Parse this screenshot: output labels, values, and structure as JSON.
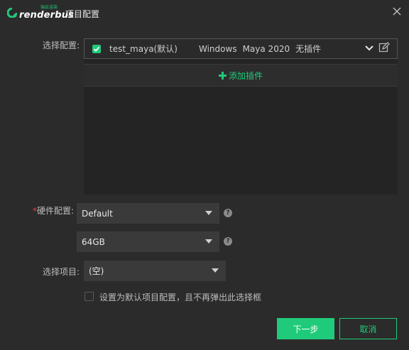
{
  "app": {
    "logo_tag": "瑞云渲染",
    "logo_word": "renderbus",
    "window_title": "项目配置"
  },
  "form": {
    "select_config_label": "选择配置:",
    "config_item": {
      "name": "test_maya(默认)",
      "os": "Windows",
      "software": "Maya 2020",
      "plugin": "无插件",
      "checked": true
    },
    "add_plugin_label": "添加插件",
    "hardware": {
      "label": "硬件配置:",
      "required_mark": "*",
      "preset_value": "Default",
      "memory_value": "64GB"
    },
    "project": {
      "label": "选择项目:",
      "value": "(空)"
    },
    "default_checkbox_label": "设置为默认项目配置，且不再弹出此选择框",
    "help_glyph": "?"
  },
  "buttons": {
    "next": "下一步",
    "cancel": "取消"
  },
  "colors": {
    "accent": "#1fcb7a",
    "background": "#2b2b2b",
    "required": "#e0443c"
  }
}
